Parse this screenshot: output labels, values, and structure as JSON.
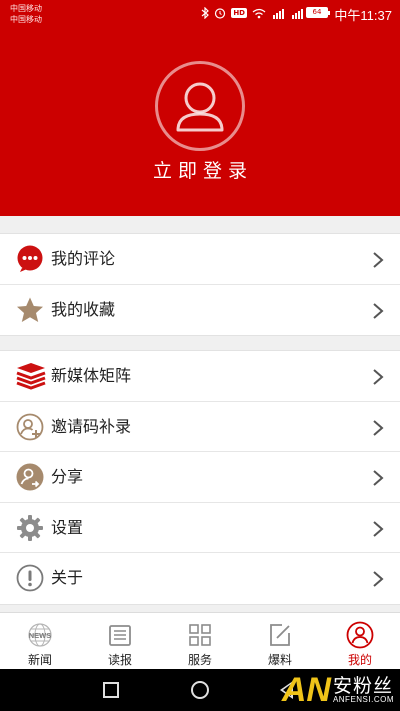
{
  "status_bar": {
    "carrier_1": "中国移动",
    "carrier_2": "中国移动",
    "hd_label": "HD",
    "battery_level": "64",
    "time": "中午11:37"
  },
  "profile": {
    "login_label": "立即登录"
  },
  "menu_group_1": [
    {
      "label": "我的评论",
      "icon": "comment-bubble-icon"
    },
    {
      "label": "我的收藏",
      "icon": "star-icon"
    }
  ],
  "menu_group_2": [
    {
      "label": "新媒体矩阵",
      "icon": "stacked-books-icon"
    },
    {
      "label": "邀请码补录",
      "icon": "add-user-icon"
    },
    {
      "label": "分享",
      "icon": "share-user-icon"
    },
    {
      "label": "设置",
      "icon": "gear-icon"
    },
    {
      "label": "关于",
      "icon": "info-exclamation-icon"
    }
  ],
  "tabs": [
    {
      "label": "新闻",
      "icon": "news-globe-icon",
      "icon_text": "NEWS"
    },
    {
      "label": "读报",
      "icon": "newspaper-icon"
    },
    {
      "label": "服务",
      "icon": "grid-icon"
    },
    {
      "label": "爆料",
      "icon": "edit-icon"
    },
    {
      "label": "我的",
      "icon": "user-icon",
      "active": true
    }
  ],
  "watermark": {
    "logo": "AN",
    "cn": "安粉丝",
    "en": "ANFENSI.COM"
  },
  "colors": {
    "brand_red": "#cc0000",
    "icon_brown": "#a68a6d",
    "comment_red": "#cc1111"
  }
}
